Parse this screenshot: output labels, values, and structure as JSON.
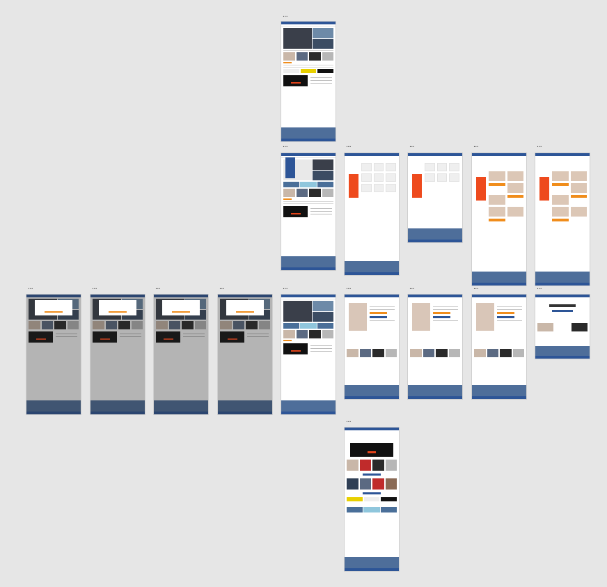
{
  "canvas": {
    "background": "#e6e6e6"
  },
  "frame_menu_label": "...",
  "brand_colors": {
    "header": "#2d5597",
    "accent": "#f08d1c",
    "sale": "#ee4a1d",
    "footer": "#4e6e9a"
  },
  "frames": [
    {
      "id": "homepage",
      "type": "home"
    },
    {
      "id": "homepage-menu-open",
      "type": "home"
    },
    {
      "id": "stores-list",
      "type": "stores"
    },
    {
      "id": "stores-detail",
      "type": "stores"
    },
    {
      "id": "fashion-list",
      "type": "fashion"
    },
    {
      "id": "fashion-list-2",
      "type": "fashion"
    },
    {
      "id": "home-modal-1",
      "type": "modal"
    },
    {
      "id": "home-modal-2",
      "type": "modal"
    },
    {
      "id": "home-modal-3",
      "type": "modal"
    },
    {
      "id": "home-modal-4",
      "type": "modal"
    },
    {
      "id": "homepage-base",
      "type": "home"
    },
    {
      "id": "product-detail-1",
      "type": "pdp"
    },
    {
      "id": "product-detail-2",
      "type": "pdp"
    },
    {
      "id": "product-detail-3",
      "type": "pdp"
    },
    {
      "id": "confirmation",
      "type": "confirm"
    },
    {
      "id": "black-friday-landing",
      "type": "landing"
    }
  ]
}
